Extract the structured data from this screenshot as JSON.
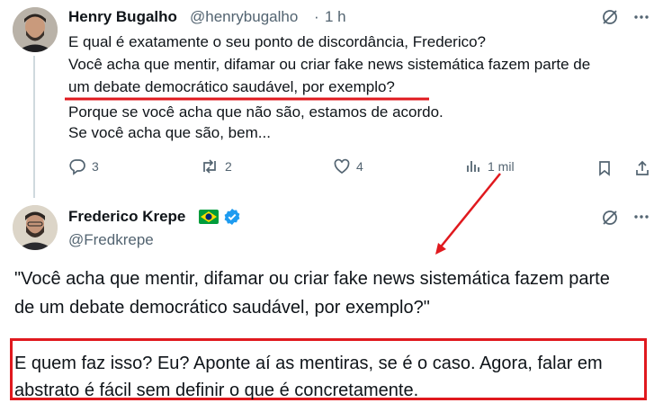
{
  "tweet1": {
    "author_name": "Henry Bugalho",
    "handle": "@henrybugalho",
    "separator": "·",
    "time": "1 h",
    "lines": [
      "E qual é exatamente o seu ponto de discordância, Frederico?",
      "Você acha que mentir, difamar ou criar fake news sistemática fazem parte de",
      "um debate democrático saudável, por exemplo?",
      "Porque se você acha que não são, estamos de acordo.",
      "Se você acha que são, bem..."
    ],
    "actions": {
      "replies": "3",
      "reposts": "2",
      "likes": "4",
      "views": "1 mil"
    },
    "icons": [
      "grok-icon",
      "more-icon",
      "reply-icon",
      "repost-icon",
      "like-icon",
      "views-icon",
      "bookmark-icon",
      "share-icon"
    ]
  },
  "tweet2": {
    "author_name": "Frederico Krepe",
    "handle": "@Fredkrepe",
    "flag": "Brazil flag",
    "quote_lines": [
      "\"Você acha que mentir, difamar ou criar fake news sistemática fazem parte",
      "de um debate democrático saudável, por exemplo?\""
    ],
    "answer_lines": [
      "E quem faz isso? Eu? Aponte aí as mentiras, se é o caso. Agora, falar em",
      "abstrato é fácil sem definir o que é concretamente."
    ]
  },
  "annotations": {
    "color": "#e0191e",
    "marks": [
      "underline",
      "arrow",
      "box"
    ]
  },
  "colors": {
    "text": "#0f1419",
    "secondary": "#536471",
    "verified": "#1d9bf0"
  }
}
